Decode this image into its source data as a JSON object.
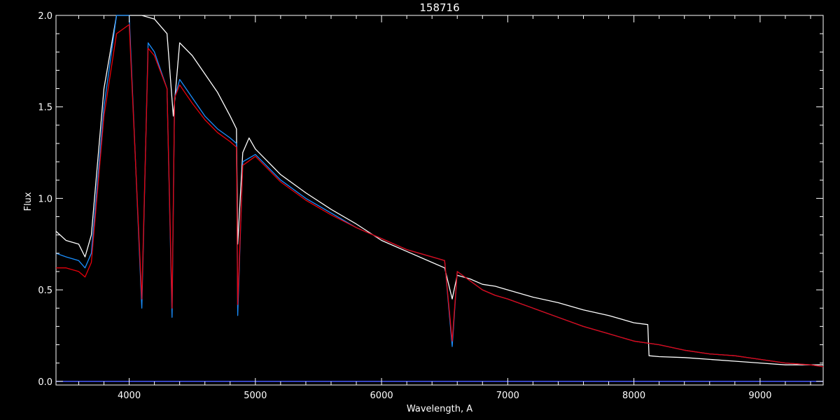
{
  "chart_data": {
    "type": "line",
    "title": "158716",
    "xlabel": "Wavelength, A",
    "ylabel": "Flux",
    "xlim": [
      3420,
      9500
    ],
    "ylim": [
      -0.02,
      2.0
    ],
    "x_ticks": [
      "4000",
      "5000",
      "6000",
      "7000",
      "8000",
      "9000"
    ],
    "y_ticks": [
      "0.0",
      "0.5",
      "1.0",
      "1.5",
      "2.0"
    ],
    "grid": false,
    "series": [
      {
        "color": "#ffffff",
        "x": [
          3420,
          3500,
          3600,
          3650,
          3700,
          3750,
          3800,
          3900,
          4000,
          4100,
          4200,
          4300,
          4350,
          4400,
          4500,
          4600,
          4700,
          4800,
          4850,
          4860,
          4900,
          4950,
          5000,
          5200,
          5400,
          5600,
          5800,
          6000,
          6200,
          6400,
          6500,
          6560,
          6600,
          6700,
          6800,
          6900,
          7000,
          7200,
          7400,
          7600,
          7800,
          8000,
          8110,
          8120,
          8200,
          8400,
          8600,
          8800,
          9000,
          9200,
          9400,
          9500
        ],
        "y": [
          0.82,
          0.77,
          0.75,
          0.68,
          0.8,
          1.2,
          1.6,
          2.0,
          2.0,
          2.0,
          1.98,
          1.9,
          1.45,
          1.85,
          1.78,
          1.68,
          1.58,
          1.45,
          1.38,
          0.75,
          1.25,
          1.33,
          1.27,
          1.13,
          1.03,
          0.94,
          0.86,
          0.77,
          0.71,
          0.65,
          0.62,
          0.45,
          0.58,
          0.56,
          0.53,
          0.52,
          0.5,
          0.46,
          0.43,
          0.39,
          0.36,
          0.32,
          0.31,
          0.14,
          0.135,
          0.13,
          0.12,
          0.11,
          0.1,
          0.09,
          0.09,
          0.09
        ]
      },
      {
        "color": "#1a8fff",
        "x": [
          3420,
          3500,
          3600,
          3650,
          3700,
          3750,
          3800,
          3900,
          4000,
          4100,
          4150,
          4200,
          4300,
          4340,
          4360,
          4400,
          4500,
          4600,
          4700,
          4800,
          4850,
          4860,
          4900,
          5000,
          5200,
          5400,
          5600,
          5800,
          6000,
          6200,
          6400,
          6500,
          6560,
          6600,
          6700,
          6800,
          6900,
          7000,
          7200,
          7400,
          7600,
          7800,
          8000,
          8200,
          8400,
          8600,
          8800,
          9000,
          9200,
          9400,
          9500
        ],
        "y": [
          0.7,
          0.68,
          0.66,
          0.62,
          0.7,
          1.1,
          1.5,
          2.0,
          2.0,
          0.4,
          1.85,
          1.8,
          1.6,
          0.35,
          1.55,
          1.65,
          1.55,
          1.45,
          1.38,
          1.33,
          1.3,
          0.36,
          1.2,
          1.24,
          1.1,
          1.0,
          0.92,
          0.84,
          0.78,
          0.72,
          0.68,
          0.66,
          0.19,
          0.6,
          0.55,
          0.5,
          0.47,
          0.45,
          0.4,
          0.35,
          0.3,
          0.26,
          0.22,
          0.2,
          0.17,
          0.15,
          0.14,
          0.12,
          0.1,
          0.09,
          0.08
        ]
      },
      {
        "color": "#e8000b",
        "x": [
          3420,
          3500,
          3600,
          3650,
          3700,
          3750,
          3800,
          3900,
          4000,
          4100,
          4150,
          4200,
          4300,
          4340,
          4360,
          4400,
          4500,
          4600,
          4700,
          4800,
          4850,
          4860,
          4900,
          5000,
          5200,
          5400,
          5600,
          5800,
          6000,
          6200,
          6400,
          6500,
          6560,
          6600,
          6700,
          6800,
          6900,
          7000,
          7200,
          7400,
          7600,
          7800,
          8000,
          8200,
          8400,
          8600,
          8800,
          9000,
          9200,
          9400,
          9500
        ],
        "y": [
          0.62,
          0.62,
          0.6,
          0.57,
          0.65,
          1.05,
          1.45,
          1.9,
          1.95,
          0.45,
          1.82,
          1.78,
          1.6,
          0.4,
          1.55,
          1.62,
          1.52,
          1.43,
          1.36,
          1.31,
          1.28,
          0.42,
          1.18,
          1.23,
          1.09,
          0.99,
          0.91,
          0.84,
          0.78,
          0.72,
          0.68,
          0.66,
          0.22,
          0.6,
          0.55,
          0.5,
          0.47,
          0.45,
          0.4,
          0.35,
          0.3,
          0.26,
          0.22,
          0.2,
          0.17,
          0.15,
          0.14,
          0.12,
          0.1,
          0.09,
          0.08
        ]
      },
      {
        "color": "#4a5cff",
        "x": [
          3420,
          4000,
          5000,
          6000,
          7000,
          8000,
          9000,
          9500
        ],
        "y": [
          0.0,
          0.0,
          0.0,
          0.0,
          0.0,
          0.0,
          0.0,
          0.0
        ]
      }
    ]
  }
}
